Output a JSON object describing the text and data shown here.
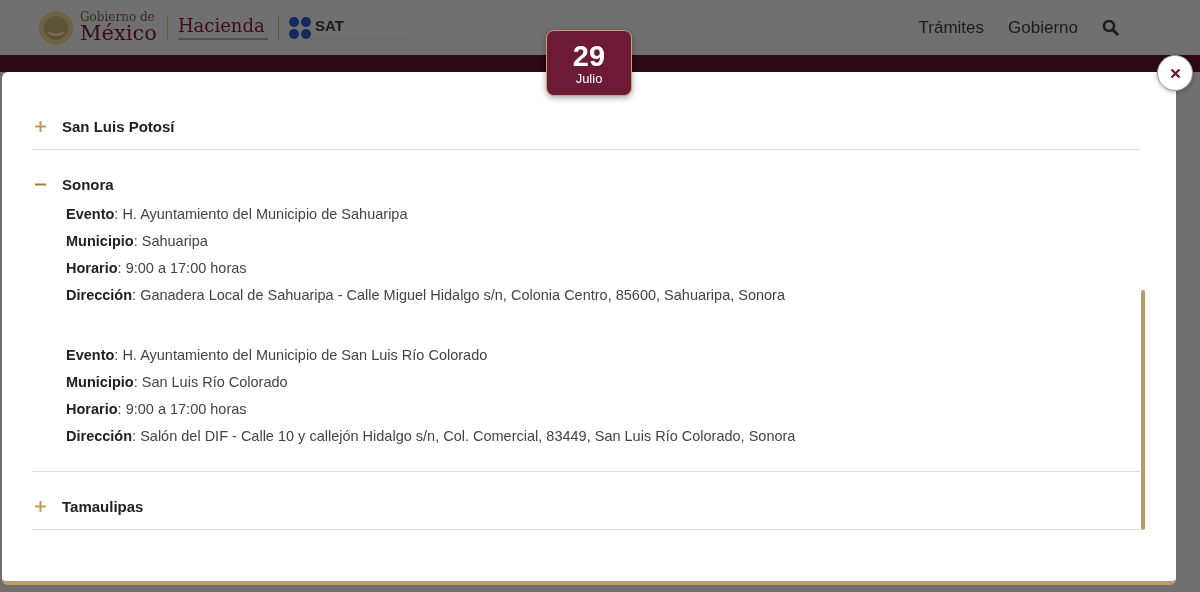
{
  "header": {
    "logo": {
      "line_1": "Gobierno de",
      "line_2": "México"
    },
    "hacienda": "Hacienda",
    "sat": "SAT",
    "nav": [
      "Trámites",
      "Gobierno"
    ]
  },
  "badge": {
    "day": "29",
    "month": "Julio"
  },
  "states": [
    {
      "name": "San Luis Potosí",
      "expanded": false
    },
    {
      "name": "Sonora",
      "expanded": true,
      "events": [
        {
          "lines": [
            "**Evento**: H. Ayuntamiento del Municipio de Sahuaripa",
            "**Municipio**: Sahuaripa",
            "**Horario**: 9:00 a 17:00 horas",
            "**Dirección**: Ganadera Local de Sahuaripa - Calle Miguel Hidalgo s/n, Colonia Centro, 85600, Sahuaripa, Sonora"
          ]
        },
        {
          "lines": [
            "**Evento**: H. Ayuntamiento del Municipio de San Luis Río Colorado",
            "**Municipio**: San Luis Río Colorado",
            "**Horario**: 9:00 a 17:00 horas",
            "**Dirección**: Salón del DIF - Calle 10 y callejón Hidalgo s/n, Col. Comercial, 83449, San Luis Río Colorado, Sonora"
          ]
        }
      ]
    },
    {
      "name": "Tamaulipas",
      "expanded": false
    }
  ]
}
